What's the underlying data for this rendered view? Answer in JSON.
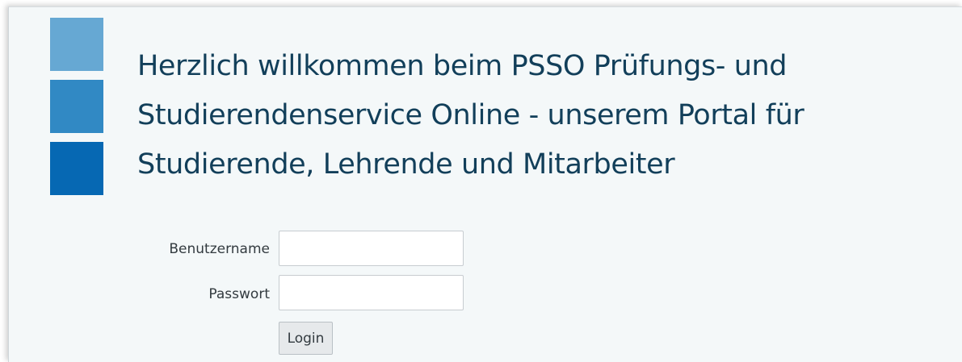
{
  "colors": {
    "logo_light": "#66a8d3",
    "logo_medium": "#3189c4",
    "logo_dark": "#0668b3",
    "title_text": "#123f5a",
    "panel_background": "#f4f8f9"
  },
  "header": {
    "title_lines": [
      "Herzlich willkommen beim PSSO Prüfungs- und",
      "Studierendenservice Online - unserem Portal für",
      "Studierende, Lehrende und Mitarbeiter"
    ]
  },
  "login_form": {
    "username_label": "Benutzername",
    "username_value": "",
    "password_label": "Passwort",
    "password_value": "",
    "login_button_label": "Login"
  }
}
